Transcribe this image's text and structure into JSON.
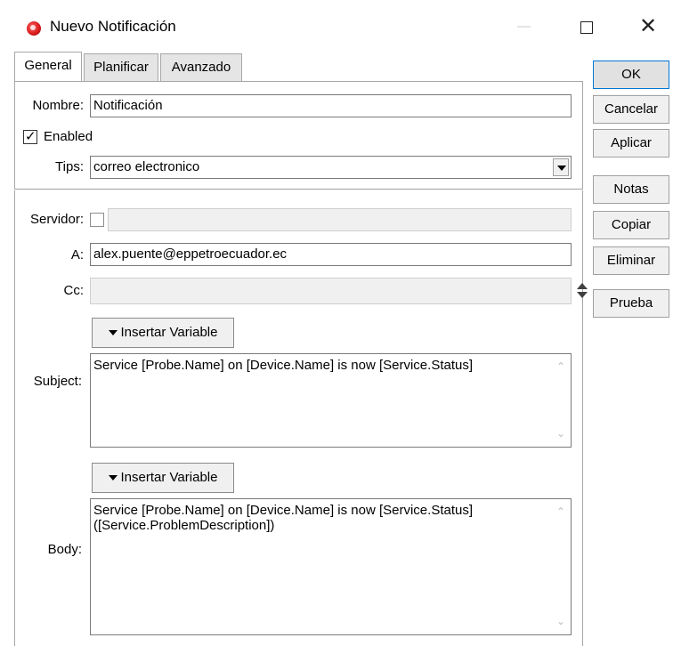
{
  "window": {
    "title": "Nuevo Notificación",
    "icon": "app-logo-icon"
  },
  "tabs": [
    {
      "label": "General",
      "active": true
    },
    {
      "label": "Planificar",
      "active": false
    },
    {
      "label": "Avanzado",
      "active": false
    }
  ],
  "form": {
    "nombre_label": "Nombre:",
    "nombre_value": "Notificación",
    "enabled_label": "Enabled",
    "enabled_checked": true,
    "tips_label": "Tips:",
    "tips_value": "correo electronico",
    "servidor_label": "Servidor:",
    "servidor_checked": false,
    "servidor_value": "",
    "a_label": "A:",
    "a_value": "alex.puente@eppetroecuador.ec",
    "cc_label": "Cc:",
    "cc_value": "",
    "insert_variable_label": "Insertar Variable",
    "subject_label": "Subject:",
    "subject_value": "Service [Probe.Name] on [Device.Name] is now [Service.Status]",
    "body_label": "Body:",
    "body_value": "Service [Probe.Name] on [Device.Name] is now [Service.Status] ([Service.ProblemDescription])"
  },
  "side_buttons": {
    "ok": "OK",
    "cancelar": "Cancelar",
    "aplicar": "Aplicar",
    "notas": "Notas",
    "copiar": "Copiar",
    "eliminar": "Eliminar",
    "prueba": "Prueba"
  }
}
